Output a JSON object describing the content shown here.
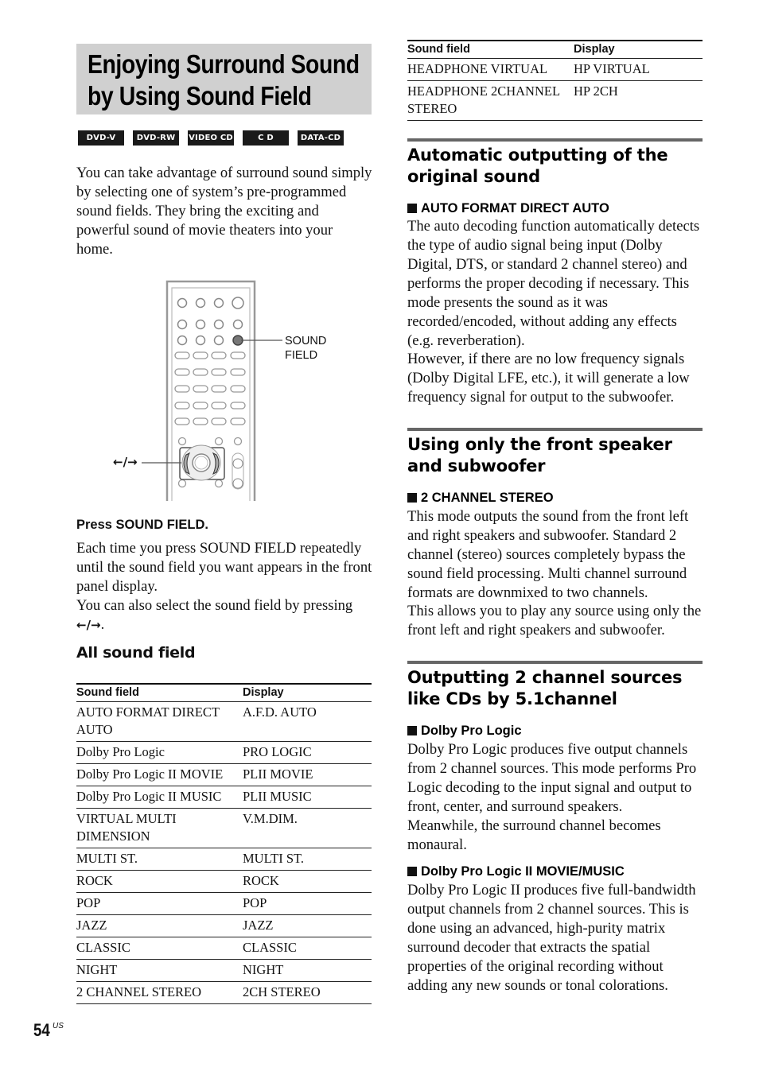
{
  "page": {
    "title_line1": "Enjoying Surround Sound",
    "title_line2": "by Using Sound Field",
    "disc_badges": [
      "DVD-V",
      "DVD-RW",
      "VIDEO CD",
      "C D",
      "DATA-CD"
    ],
    "intro": "You can take advantage of surround sound simply by selecting one of system’s pre-programmed sound fields. They bring the exciting and powerful sound of movie theaters into your home.",
    "diagram": {
      "sound_field_label_1": "SOUND",
      "sound_field_label_2": "FIELD",
      "arrow_label": "←/→"
    },
    "step": {
      "heading": "Press SOUND FIELD.",
      "body1": "Each time you press SOUND FIELD repeatedly until the sound field you want appears in the front panel display.",
      "body2": "You can also select the sound field by pressing",
      "arrows": "←/→",
      "period": "."
    },
    "all_sound_field": {
      "heading": "All sound field",
      "columns": [
        "Sound field",
        "Display"
      ],
      "rows": [
        [
          "AUTO FORMAT DIRECT AUTO",
          "A.F.D. AUTO"
        ],
        [
          "Dolby Pro Logic",
          "PRO LOGIC"
        ],
        [
          "Dolby Pro Logic II MOVIE",
          "PLII MOVIE"
        ],
        [
          "Dolby Pro Logic II MUSIC",
          "PLII MUSIC"
        ],
        [
          "VIRTUAL MULTI DIMENSION",
          "V.M.DIM."
        ],
        [
          "MULTI ST.",
          "MULTI ST."
        ],
        [
          "ROCK",
          "ROCK"
        ],
        [
          "POP",
          "POP"
        ],
        [
          "JAZZ",
          "JAZZ"
        ],
        [
          "CLASSIC",
          "CLASSIC"
        ],
        [
          "NIGHT",
          "NIGHT"
        ],
        [
          "2 CHANNEL STEREO",
          "2CH STEREO"
        ]
      ],
      "continued_rows": [
        [
          "HEADPHONE VIRTUAL",
          "HP VIRTUAL"
        ],
        [
          "HEADPHONE 2CHANNEL STEREO",
          "HP 2CH"
        ]
      ]
    },
    "sections": [
      {
        "heading": "Automatic outputting of the original sound",
        "subheading": "AUTO FORMAT DIRECT AUTO",
        "body1": "The auto decoding function automatically detects the type of audio signal being input (Dolby Digital, DTS, or standard 2 channel stereo) and performs the proper decoding if necessary. This mode presents the sound as it was recorded/encoded, without adding any effects (e.g. reverberation).",
        "body2": "However, if there are no low frequency signals (Dolby Digital LFE, etc.), it will generate a low frequency signal for output to the subwoofer."
      },
      {
        "heading": "Using only the front speaker and subwoofer",
        "subheading": "2 CHANNEL STEREO",
        "body1": "This mode outputs the sound from the front left and right speakers and subwoofer. Standard 2 channel (stereo) sources completely bypass the sound field processing. Multi channel surround formats are downmixed to two channels.",
        "body2": "This allows you to play any source using only the front left and right speakers and subwoofer."
      },
      {
        "heading": "Outputting 2 channel sources like CDs by 5.1channel",
        "subheading": "Dolby Pro Logic",
        "body1": "Dolby Pro Logic produces five output channels from 2 channel sources. This mode performs Pro Logic decoding to the input signal and output to front, center, and surround speakers.",
        "body2": "Meanwhile, the surround channel becomes monaural.",
        "subheading2": "Dolby Pro Logic II MOVIE/MUSIC",
        "body3": "Dolby Pro Logic II produces five full-bandwidth output channels from 2 channel sources. This is done using an advanced, high-purity matrix surround decoder that extracts the spatial properties of the original recording without adding any new sounds or tonal colorations."
      }
    ],
    "page_number": "54",
    "page_suffix": "US"
  }
}
